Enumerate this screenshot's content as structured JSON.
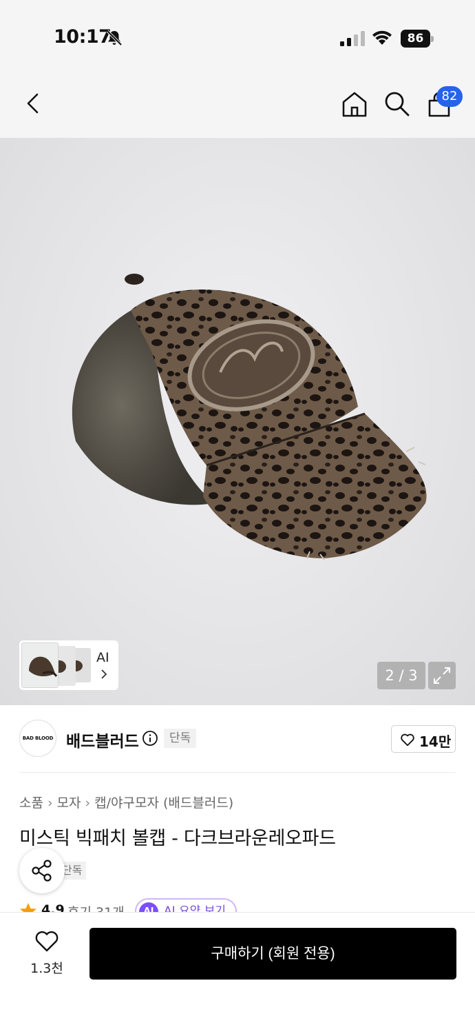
{
  "status_bar": {
    "time": "10:17",
    "battery": "86"
  },
  "header": {
    "cart_badge": "82"
  },
  "gallery": {
    "counter": "2 / 3",
    "ai_label": "AI"
  },
  "brand": {
    "logo_text": "BAD BLOOD",
    "name": "배드블러드",
    "tag": "단독",
    "likes": "14만"
  },
  "breadcrumb": [
    "소품",
    "모자",
    "캡/야구모자 (배드블러드)"
  ],
  "product": {
    "title": "미스틱 빅패치 볼캡 - 다크브라운레오파드",
    "tag": "단독",
    "rating": "4.9",
    "reviews": "후기 31개",
    "ai_summary_label": "AI 요약 보기",
    "ai_badge": "AI"
  },
  "bottom_bar": {
    "wish_count": "1.3천",
    "buy_label": "구매하기 (회원 전용)"
  }
}
